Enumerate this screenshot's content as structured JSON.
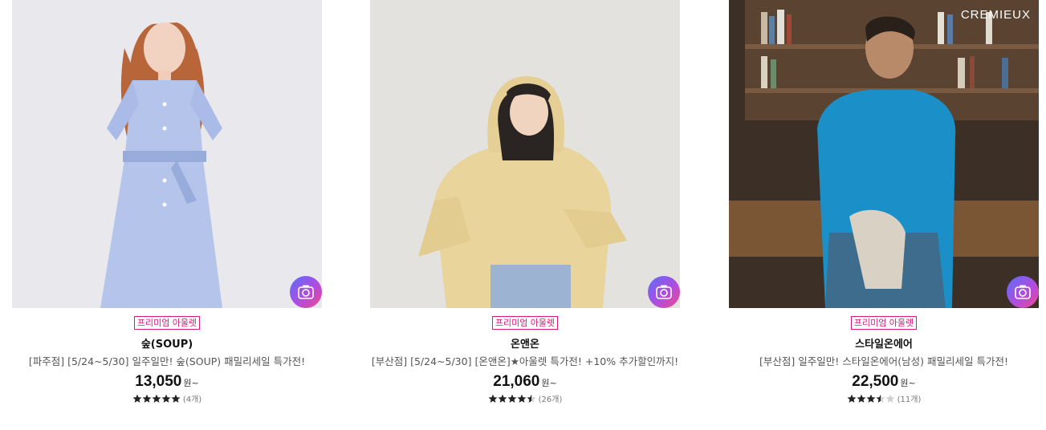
{
  "products": [
    {
      "badge": "프리미엄 아울렛",
      "brand": "숲(SOUP)",
      "title": "[파주점] [5/24~5/30] 일주일만! 숲(SOUP) 패밀리세일 특가전!",
      "price": "13,050",
      "price_unit": "원~",
      "rating": 5,
      "review_count": "(4개)"
    },
    {
      "badge": "프리미엄 아울렛",
      "brand": "온앤온",
      "title": "[부산점] [5/24~5/30] [온앤온]★아울렛 특가전! +10% 추가할인까지!",
      "price": "21,060",
      "price_unit": "원~",
      "rating": 4.5,
      "review_count": "(26개)"
    },
    {
      "badge": "프리미엄 아울렛",
      "brand": "스타일온에어",
      "title": "[부산점] 일주일만! 스타일온에어(남성) 패밀리세일 특가전!",
      "price": "22,500",
      "price_unit": "원~",
      "rating": 3.5,
      "review_count": "(11개)",
      "image_brand_text": "CREMIEUX"
    }
  ],
  "icons": {
    "camera": "camera-icon",
    "star": "star-icon"
  },
  "colors": {
    "badge": "#d81b7a",
    "star_filled": "#222222",
    "star_empty": "#d0d0d0"
  }
}
